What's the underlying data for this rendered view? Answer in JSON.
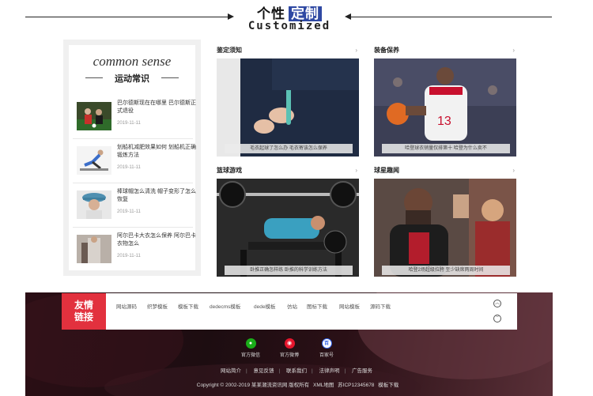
{
  "header": {
    "title_main": "个性",
    "title_highlight": "定制",
    "subtitle": "Customized"
  },
  "sense": {
    "title_en": "common sense",
    "title_cn": "运动常识",
    "items": [
      {
        "text": "巴尔德斯现在在哪里 巴尔德斯正式退役",
        "date": "2019-11-11"
      },
      {
        "text": "划船机减肥效果如何 划船机正确锻炼方法",
        "date": "2019-11-11"
      },
      {
        "text": "棒球帽怎么清洗 帽子变形了怎么恢复",
        "date": "2019-11-11"
      },
      {
        "text": "阿尔巴卡大衣怎么保养 阿尔巴卡衣物怎么",
        "date": "2019-11-11"
      }
    ]
  },
  "cards": [
    {
      "heading": "鉴定须知",
      "caption": "毛衣起球了怎么办 毛衣寄该怎么保养"
    },
    {
      "heading": "装备保养",
      "caption": "哈登球衣销量仅排第十 哈登为什么卖不"
    },
    {
      "heading": "篮球游戏",
      "caption": "卧推正确怎样练 卧推的科学训练方法"
    },
    {
      "heading": "球星趣闻",
      "caption": "哈登2场超级拉胯 至少缺席两周时间"
    }
  ],
  "friend_links": {
    "badge_line1": "友情",
    "badge_line2": "链接",
    "items": [
      "网站源码",
      "织梦模板",
      "模板下载",
      "dedecms模板",
      "dede模板",
      "仿站",
      "图标下载",
      "网站模板",
      "源码下载"
    ]
  },
  "social": [
    {
      "label": "官方微信",
      "icon": "wechat-icon",
      "color": "#1aad19"
    },
    {
      "label": "官方微博",
      "icon": "weibo-icon",
      "color": "#e6162d"
    },
    {
      "label": "百家号",
      "icon": "baijiahao-icon",
      "color": "#2e60e9"
    }
  ],
  "footer_nav": [
    "网站简介",
    "意见反馈",
    "联系我们",
    "法律声明",
    "广告服务"
  ],
  "copyright": {
    "text": "Copyright © 2002-2019 某某潮流资讯网 版权所有",
    "sitemap": "XML地图",
    "icp": "苏ICP12345678",
    "template": "模板下载"
  }
}
